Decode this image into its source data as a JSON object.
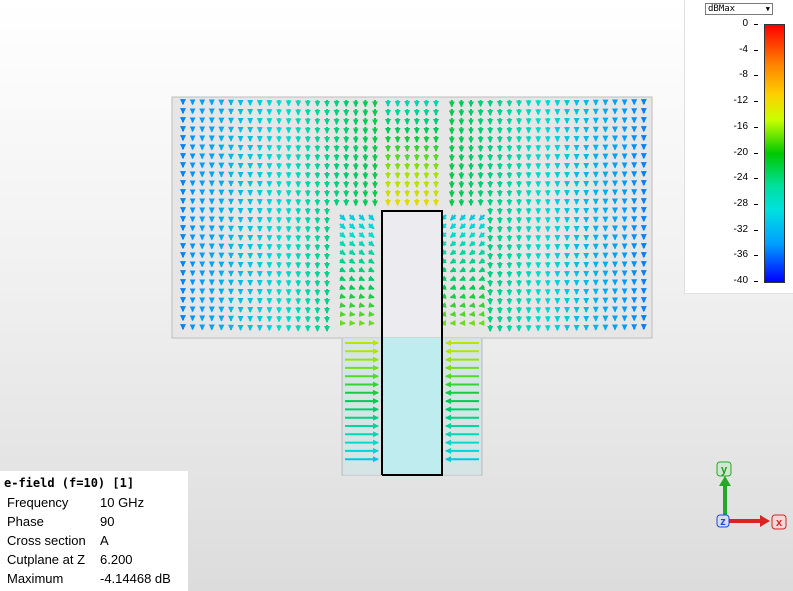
{
  "legend": {
    "dropdown": "dBMax",
    "ticks": [
      "0",
      "-4",
      "-8",
      "-12",
      "-16",
      "-20",
      "-24",
      "-28",
      "-32",
      "-36",
      "-40"
    ]
  },
  "info": {
    "title": "e-field (f=10) [1]",
    "rows": [
      {
        "label": "Frequency",
        "value": "10 GHz"
      },
      {
        "label": "Phase",
        "value": "90"
      },
      {
        "label": "Cross section",
        "value": "A"
      },
      {
        "label": "Cutplane at Z",
        "value": "6.200"
      },
      {
        "label": "Maximum",
        "value": "-4.14468 dB"
      }
    ]
  },
  "axes": {
    "y": "y",
    "z": "z",
    "x": "x"
  },
  "colors": {
    "axis_y": "#22aa22",
    "axis_x": "#dd2222",
    "axis_z": "#2244dd",
    "dielectric": "#bfecee",
    "conductor_outline": "#000000"
  }
}
